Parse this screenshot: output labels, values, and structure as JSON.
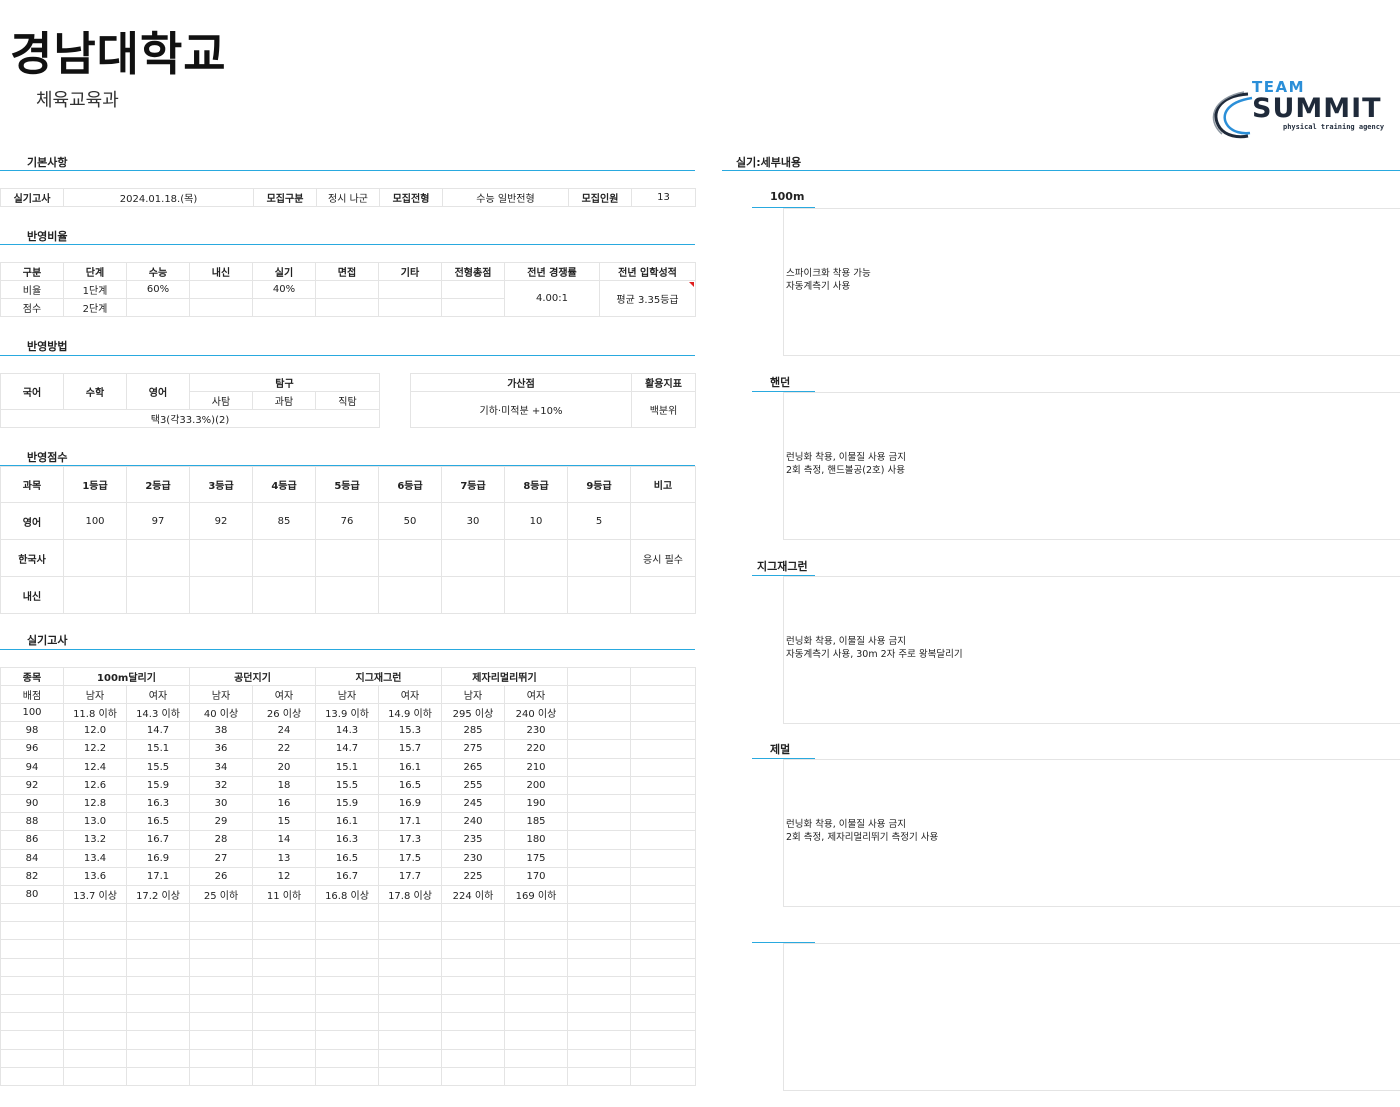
{
  "header": {
    "title": "경남대학교",
    "subtitle": "체육교육과"
  },
  "logo": {
    "line1": "TEAM",
    "line2": "SUMMIT",
    "tagline": "physical training agency",
    "color_dark": "#1f2a3a",
    "color_blue": "#2b8fd8"
  },
  "sections": {
    "basic": "기본사항",
    "ratio": "반영비율",
    "method": "반영방법",
    "score": "반영점수",
    "practical": "실기고사",
    "detail": "실기:세부내용"
  },
  "basic": {
    "exam_label": "실기고사",
    "exam_value": "2024.01.18.(목)",
    "group_label": "모집구분",
    "group_value": "정시 나군",
    "type_label": "모집전형",
    "type_value": "수능 일반전형",
    "quota_label": "모집인원",
    "quota_value": "13"
  },
  "ratio": {
    "headers": [
      "구분",
      "단계",
      "수능",
      "내신",
      "실기",
      "면접",
      "기타",
      "전형총점",
      "전년 경쟁률",
      "전년 입학성적"
    ],
    "row1": [
      "비율",
      "1단계",
      "60%",
      "",
      "40%",
      "",
      "",
      ""
    ],
    "row2": [
      "점수",
      "2단계",
      "",
      "",
      "",
      "",
      "",
      ""
    ],
    "competition": "4.00:1",
    "admission": "평균 3.35등급"
  },
  "method": {
    "korean": "국어",
    "math": "수학",
    "english": "영어",
    "inquiry": "탐구",
    "social": "사탐",
    "science": "과탐",
    "vocational": "직탐",
    "selection": "택3(각33.3%)(2)",
    "bonus_label": "가산점",
    "bonus_value": "기하·미적분 +10%",
    "index_label": "활용지표",
    "index_value": "백분위"
  },
  "score": {
    "headers": [
      "과목",
      "1등급",
      "2등급",
      "3등급",
      "4등급",
      "5등급",
      "6등급",
      "7등급",
      "8등급",
      "9등급",
      "비고"
    ],
    "rows": [
      [
        "영어",
        "100",
        "97",
        "92",
        "85",
        "76",
        "50",
        "30",
        "10",
        "5",
        ""
      ],
      [
        "한국사",
        "",
        "",
        "",
        "",
        "",
        "",
        "",
        "",
        "",
        "응시 필수"
      ],
      [
        "내신",
        "",
        "",
        "",
        "",
        "",
        "",
        "",
        "",
        "",
        ""
      ]
    ]
  },
  "practical": {
    "event_label": "종목",
    "events": [
      "100m달리기",
      "공던지기",
      "지그재그런",
      "제자리멀리뛰기"
    ],
    "score_label": "배점",
    "male": "남자",
    "female": "여자",
    "rows": [
      [
        "100",
        "11.8 이하",
        "14.3 이하",
        "40 이상",
        "26 이상",
        "13.9 이하",
        "14.9 이하",
        "295 이상",
        "240 이상"
      ],
      [
        "98",
        "12.0",
        "14.7",
        "38",
        "24",
        "14.3",
        "15.3",
        "285",
        "230"
      ],
      [
        "96",
        "12.2",
        "15.1",
        "36",
        "22",
        "14.7",
        "15.7",
        "275",
        "220"
      ],
      [
        "94",
        "12.4",
        "15.5",
        "34",
        "20",
        "15.1",
        "16.1",
        "265",
        "210"
      ],
      [
        "92",
        "12.6",
        "15.9",
        "32",
        "18",
        "15.5",
        "16.5",
        "255",
        "200"
      ],
      [
        "90",
        "12.8",
        "16.3",
        "30",
        "16",
        "15.9",
        "16.9",
        "245",
        "190"
      ],
      [
        "88",
        "13.0",
        "16.5",
        "29",
        "15",
        "16.1",
        "17.1",
        "240",
        "185"
      ],
      [
        "86",
        "13.2",
        "16.7",
        "28",
        "14",
        "16.3",
        "17.3",
        "235",
        "180"
      ],
      [
        "84",
        "13.4",
        "16.9",
        "27",
        "13",
        "16.5",
        "17.5",
        "230",
        "175"
      ],
      [
        "82",
        "13.6",
        "17.1",
        "26",
        "12",
        "16.7",
        "17.7",
        "225",
        "170"
      ],
      [
        "80",
        "13.7 이상",
        "17.2 이상",
        "25 이하",
        "11 이하",
        "16.8 이상",
        "17.8 이상",
        "224 이하",
        "169 이하"
      ]
    ]
  },
  "details": [
    {
      "title": "100m",
      "line1": "스파이크화 착용 가능",
      "line2": "자동계측기 사용"
    },
    {
      "title": "핸던",
      "line1": "런닝화 착용, 이물질 사용 금지",
      "line2": "2회 측정, 핸드볼공(2호) 사용"
    },
    {
      "title": "지그재그런",
      "line1": "런닝화 착용, 이물질 사용 금지",
      "line2": "자동계측기 사용, 30m 2자 주로 왕복달리기"
    },
    {
      "title": "제멀",
      "line1": "런닝화 착용, 이물질 사용 금지",
      "line2": "2회 측정, 제자리멀리뛰기 측정기 사용"
    },
    {
      "title": "",
      "line1": "",
      "line2": ""
    }
  ]
}
